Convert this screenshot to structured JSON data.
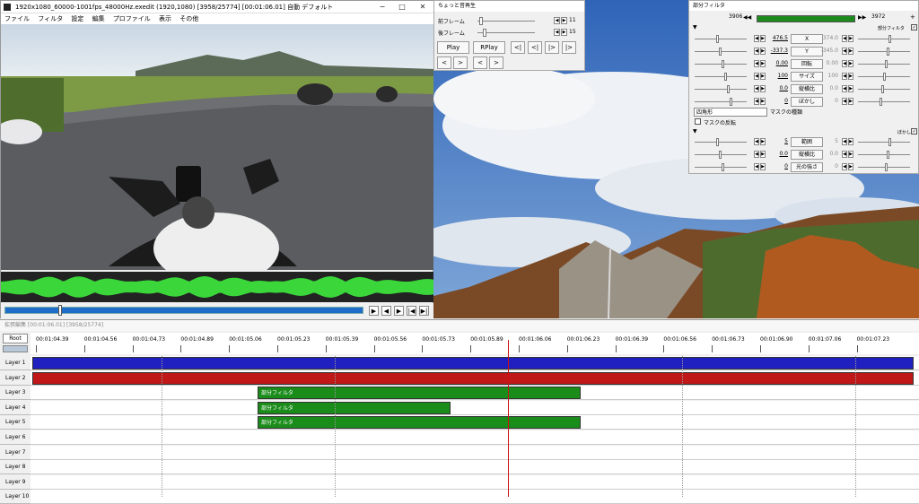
{
  "window": {
    "title": "1920x1080_60000-1001fps_48000Hz.exedit (1920,1080)  [3958/25774] [00:01:06.01]  自動  デフォルト"
  },
  "menu": [
    "ファイル",
    "フィルタ",
    "設定",
    "編集",
    "プロファイル",
    "表示",
    "その他"
  ],
  "player": {
    "title": "ちょっと音再生",
    "rows": [
      {
        "label": "前フレーム",
        "value": "11"
      },
      {
        "label": "後フレーム",
        "value": "15"
      }
    ],
    "play": "Play",
    "rplay": "RPlay",
    "nav": [
      "<|",
      "<|",
      "|>",
      "|>"
    ],
    "arrows": [
      "<",
      ">",
      "<",
      ">"
    ]
  },
  "filter": {
    "title": "部分フィルタ",
    "range_start": "3906",
    "range_end": "3972",
    "section1": "部分フィルタ",
    "section2": "ぼかし",
    "rows1": [
      {
        "a": "476.5",
        "btn": "X",
        "b": "374.0"
      },
      {
        "a": "-337.3",
        "btn": "Y",
        "b": "-345.0"
      },
      {
        "a": "0.00",
        "btn": "回転",
        "b": "0.00"
      },
      {
        "a": "100",
        "btn": "サイズ",
        "b": "100"
      },
      {
        "a": "0.0",
        "btn": "縦横比",
        "b": "0.0"
      },
      {
        "a": "0",
        "btn": "ぼかし",
        "b": "0"
      }
    ],
    "shape": "四角形",
    "mask_type": "マスクの種類",
    "invert": "マスクの反転",
    "rows2": [
      {
        "a": "5",
        "btn": "範囲",
        "b": "5"
      },
      {
        "a": "0.0",
        "btn": "縦横比",
        "b": "0.0"
      },
      {
        "a": "0",
        "btn": "光の強さ",
        "b": "0"
      }
    ]
  },
  "timeline": {
    "title": "拡張編集 [00:01:06.01] [3958/25774]",
    "root": "Root",
    "ticks": [
      "00:01:04.39",
      "00:01:04.56",
      "00:01:04.73",
      "00:01:04.89",
      "00:01:05.06",
      "00:01:05.23",
      "00:01:05.39",
      "00:01:05.56",
      "00:01:05.73",
      "00:01:05.89",
      "00:01:06.06",
      "00:01:06.23",
      "00:01:06.39",
      "00:01:06.56",
      "00:01:06.73",
      "00:01:06.90",
      "00:01:07.06",
      "00:01:07.23"
    ],
    "layers": [
      "Layer 1",
      "Layer 2",
      "Layer 3",
      "Layer 4",
      "Layer 5",
      "Layer 6",
      "Layer 7",
      "Layer 8",
      "Layer 9",
      "Layer 10"
    ],
    "clip_label": "部分フィルタ",
    "colors": {
      "layer1": "#2020c0",
      "layer2": "#c01818",
      "clip": "#1a8c1a"
    }
  }
}
